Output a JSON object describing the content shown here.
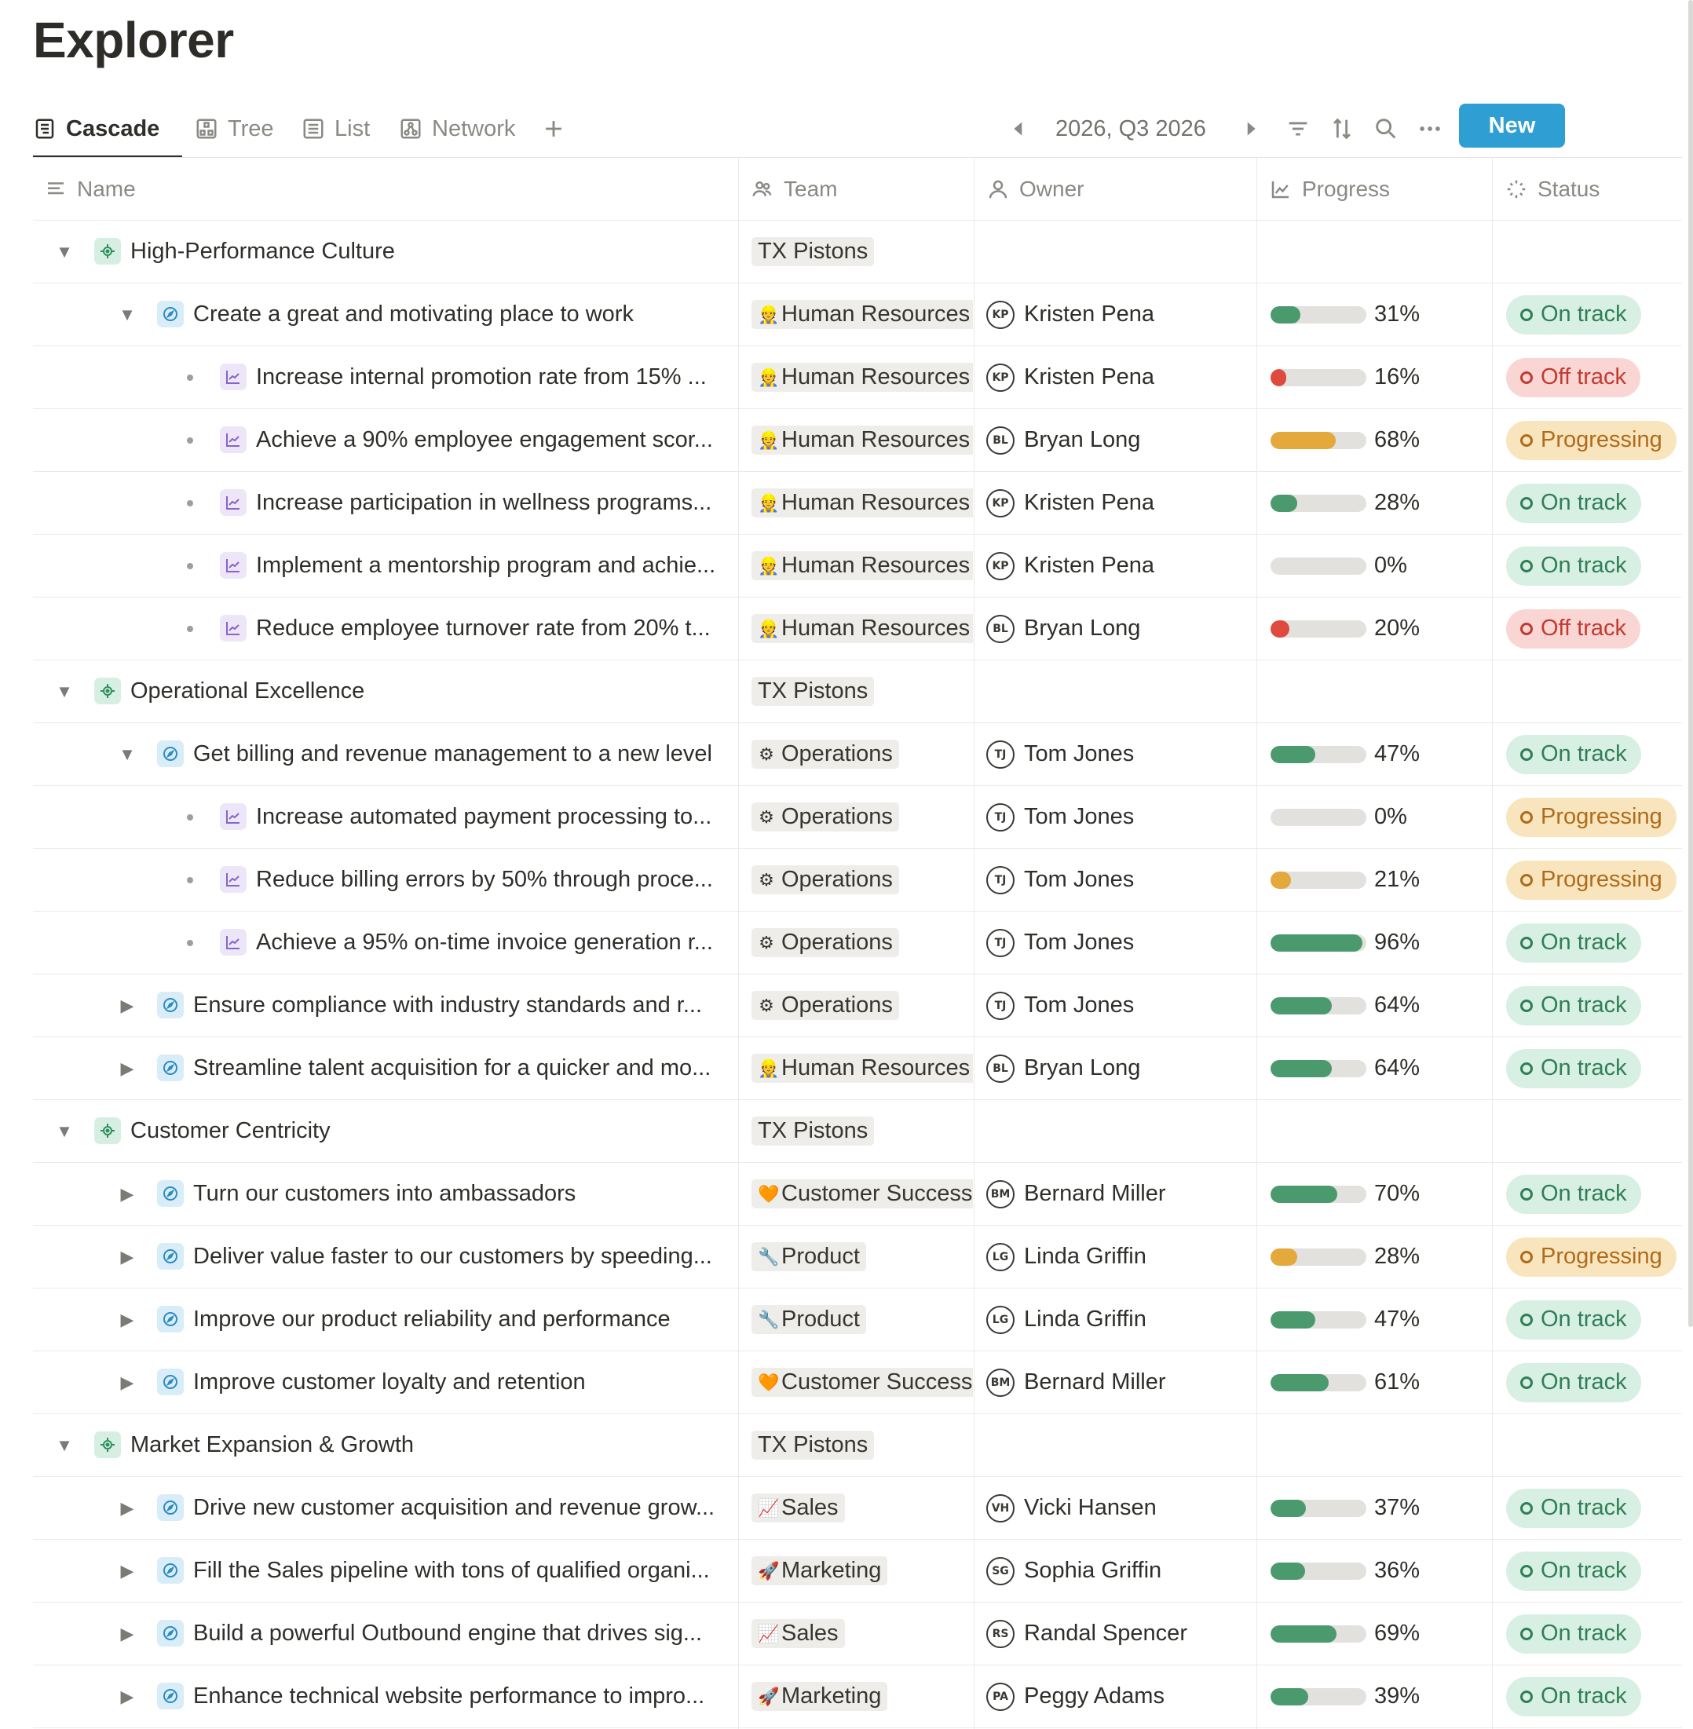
{
  "page": {
    "title": "Explorer"
  },
  "tabs": [
    {
      "label": "Cascade",
      "icon": "cascade-icon",
      "active": true
    },
    {
      "label": "Tree",
      "icon": "tree-icon",
      "active": false
    },
    {
      "label": "List",
      "icon": "list-icon",
      "active": false
    },
    {
      "label": "Network",
      "icon": "network-icon",
      "active": false
    }
  ],
  "toolbar": {
    "period": "2026, Q3 2026",
    "new_label": "New",
    "icons": [
      "prev-period-icon",
      "next-period-icon",
      "filter-icon",
      "sort-icon",
      "search-icon",
      "more-icon",
      "add-view-icon"
    ]
  },
  "columns": {
    "name": "Name",
    "team": "Team",
    "owner": "Owner",
    "progress": "Progress",
    "status": "Status"
  },
  "colors": {
    "on_track_bg": "#d8efe3",
    "on_track_fg": "#2f7f56",
    "off_track_bg": "#f9d6d3",
    "off_track_fg": "#c23a31",
    "progressing_bg": "#f8e5bd",
    "progressing_fg": "#b06b1a",
    "bar_green": "#4a9a6d",
    "bar_orange": "#e4a83b",
    "bar_red": "#de4b3e",
    "new_button": "#2f9ed3"
  },
  "rows": [
    {
      "level": 0,
      "type": "objective",
      "toggle": "expanded",
      "name": "High-Performance Culture",
      "team": {
        "label": "TX Pistons"
      }
    },
    {
      "level": 1,
      "type": "goal",
      "toggle": "expanded",
      "name": "Create a great and motivating place to work",
      "team": {
        "emoji": "👷",
        "label": "Human Resources"
      },
      "owner": {
        "initials": "KP",
        "name": "Kristen Pena"
      },
      "progress": 31,
      "progress_color": "green",
      "status": "On track"
    },
    {
      "level": 2,
      "type": "kr",
      "toggle": "bullet",
      "name": "Increase internal promotion rate from 15% ...",
      "team": {
        "emoji": "👷",
        "label": "Human Resources"
      },
      "owner": {
        "initials": "KP",
        "name": "Kristen Pena"
      },
      "progress": 16,
      "progress_color": "red",
      "status": "Off track"
    },
    {
      "level": 2,
      "type": "kr",
      "toggle": "bullet",
      "name": "Achieve a 90% employee engagement scor...",
      "team": {
        "emoji": "👷",
        "label": "Human Resources"
      },
      "owner": {
        "initials": "BL",
        "name": "Bryan Long"
      },
      "progress": 68,
      "progress_color": "orange",
      "status": "Progressing"
    },
    {
      "level": 2,
      "type": "kr",
      "toggle": "bullet",
      "name": "Increase participation in wellness programs...",
      "team": {
        "emoji": "👷",
        "label": "Human Resources"
      },
      "owner": {
        "initials": "KP",
        "name": "Kristen Pena"
      },
      "progress": 28,
      "progress_color": "green",
      "status": "On track"
    },
    {
      "level": 2,
      "type": "kr",
      "toggle": "bullet",
      "name": "Implement a mentorship program and achie...",
      "team": {
        "emoji": "👷",
        "label": "Human Resources"
      },
      "owner": {
        "initials": "KP",
        "name": "Kristen Pena"
      },
      "progress": 0,
      "progress_color": "green",
      "status": "On track"
    },
    {
      "level": 2,
      "type": "kr",
      "toggle": "bullet",
      "name": "Reduce employee turnover rate from 20% t...",
      "team": {
        "emoji": "👷",
        "label": "Human Resources"
      },
      "owner": {
        "initials": "BL",
        "name": "Bryan Long"
      },
      "progress": 20,
      "progress_color": "red",
      "status": "Off track"
    },
    {
      "level": 0,
      "type": "objective",
      "toggle": "expanded",
      "name": "Operational Excellence",
      "team": {
        "label": "TX Pistons"
      }
    },
    {
      "level": 1,
      "type": "goal",
      "toggle": "expanded",
      "name": "Get billing and revenue management to a new level",
      "team": {
        "emoji": "⚙",
        "label": "Operations"
      },
      "owner": {
        "initials": "TJ",
        "name": "Tom Jones"
      },
      "progress": 47,
      "progress_color": "green",
      "status": "On track"
    },
    {
      "level": 2,
      "type": "kr",
      "toggle": "bullet",
      "name": "Increase automated payment processing to...",
      "team": {
        "emoji": "⚙",
        "label": "Operations"
      },
      "owner": {
        "initials": "TJ",
        "name": "Tom Jones"
      },
      "progress": 0,
      "progress_color": "orange",
      "status": "Progressing"
    },
    {
      "level": 2,
      "type": "kr",
      "toggle": "bullet",
      "name": "Reduce billing errors by 50% through proce...",
      "team": {
        "emoji": "⚙",
        "label": "Operations"
      },
      "owner": {
        "initials": "TJ",
        "name": "Tom Jones"
      },
      "progress": 21,
      "progress_color": "orange",
      "status": "Progressing"
    },
    {
      "level": 2,
      "type": "kr",
      "toggle": "bullet",
      "name": "Achieve a 95% on-time invoice generation r...",
      "team": {
        "emoji": "⚙",
        "label": "Operations"
      },
      "owner": {
        "initials": "TJ",
        "name": "Tom Jones"
      },
      "progress": 96,
      "progress_color": "green",
      "status": "On track"
    },
    {
      "level": 1,
      "type": "goal",
      "toggle": "collapsed",
      "name": "Ensure compliance with industry standards and r...",
      "team": {
        "emoji": "⚙",
        "label": "Operations"
      },
      "owner": {
        "initials": "TJ",
        "name": "Tom Jones"
      },
      "progress": 64,
      "progress_color": "green",
      "status": "On track"
    },
    {
      "level": 1,
      "type": "goal",
      "toggle": "collapsed",
      "name": "Streamline talent acquisition for a quicker and mo...",
      "team": {
        "emoji": "👷",
        "label": "Human Resources"
      },
      "owner": {
        "initials": "BL",
        "name": "Bryan Long"
      },
      "progress": 64,
      "progress_color": "green",
      "status": "On track"
    },
    {
      "level": 0,
      "type": "objective",
      "toggle": "expanded",
      "name": "Customer Centricity",
      "team": {
        "label": "TX Pistons"
      }
    },
    {
      "level": 1,
      "type": "goal",
      "toggle": "collapsed",
      "name": "Turn our customers into ambassadors",
      "team": {
        "emoji": "🧡",
        "label": "Customer Success"
      },
      "owner": {
        "initials": "BM",
        "name": "Bernard Miller"
      },
      "progress": 70,
      "progress_color": "green",
      "status": "On track"
    },
    {
      "level": 1,
      "type": "goal",
      "toggle": "collapsed",
      "name": "Deliver value faster to our customers by speeding...",
      "team": {
        "emoji": "🔧",
        "label": "Product"
      },
      "owner": {
        "initials": "LG",
        "name": "Linda Griffin"
      },
      "progress": 28,
      "progress_color": "orange",
      "status": "Progressing"
    },
    {
      "level": 1,
      "type": "goal",
      "toggle": "collapsed",
      "name": "Improve our product reliability and performance",
      "team": {
        "emoji": "🔧",
        "label": "Product"
      },
      "owner": {
        "initials": "LG",
        "name": "Linda Griffin"
      },
      "progress": 47,
      "progress_color": "green",
      "status": "On track"
    },
    {
      "level": 1,
      "type": "goal",
      "toggle": "collapsed",
      "name": "Improve customer loyalty and retention",
      "team": {
        "emoji": "🧡",
        "label": "Customer Success"
      },
      "owner": {
        "initials": "BM",
        "name": "Bernard Miller"
      },
      "progress": 61,
      "progress_color": "green",
      "status": "On track"
    },
    {
      "level": 0,
      "type": "objective",
      "toggle": "expanded",
      "name": "Market Expansion & Growth",
      "team": {
        "label": "TX Pistons"
      }
    },
    {
      "level": 1,
      "type": "goal",
      "toggle": "collapsed",
      "name": "Drive new customer acquisition and revenue grow...",
      "team": {
        "emoji": "📈",
        "label": "Sales"
      },
      "owner": {
        "initials": "VH",
        "name": "Vicki Hansen"
      },
      "progress": 37,
      "progress_color": "green",
      "status": "On track"
    },
    {
      "level": 1,
      "type": "goal",
      "toggle": "collapsed",
      "name": "Fill the Sales pipeline with tons of qualified organi...",
      "team": {
        "emoji": "🚀",
        "label": "Marketing"
      },
      "owner": {
        "initials": "SG",
        "name": "Sophia Griffin"
      },
      "progress": 36,
      "progress_color": "green",
      "status": "On track"
    },
    {
      "level": 1,
      "type": "goal",
      "toggle": "collapsed",
      "name": "Build a powerful Outbound engine that drives sig...",
      "team": {
        "emoji": "📈",
        "label": "Sales"
      },
      "owner": {
        "initials": "RS",
        "name": "Randal Spencer"
      },
      "progress": 69,
      "progress_color": "green",
      "status": "On track"
    },
    {
      "level": 1,
      "type": "goal",
      "toggle": "collapsed",
      "name": "Enhance technical website performance to impro...",
      "team": {
        "emoji": "🚀",
        "label": "Marketing"
      },
      "owner": {
        "initials": "PA",
        "name": "Peggy Adams"
      },
      "progress": 39,
      "progress_color": "green",
      "status": "On track"
    }
  ]
}
